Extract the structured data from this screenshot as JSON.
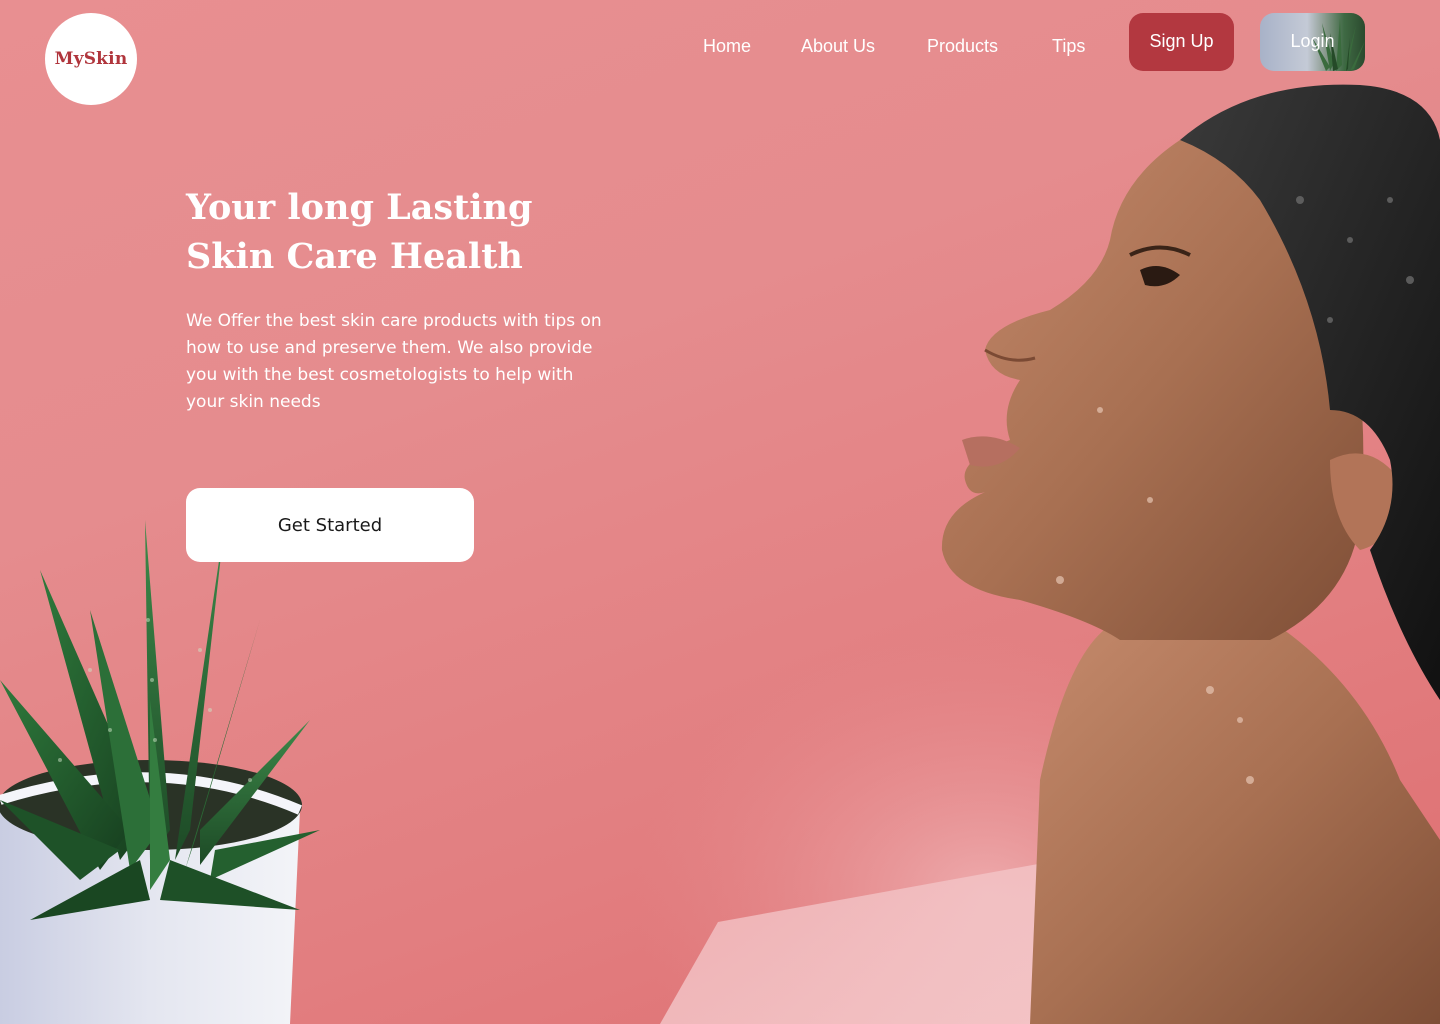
{
  "brand": {
    "logo_text": "MySkin",
    "accent_color": "#b33840",
    "background_color": "#e58c8e"
  },
  "nav": {
    "links": [
      {
        "label": "Home"
      },
      {
        "label": "About Us"
      },
      {
        "label": "Products"
      },
      {
        "label": "Tips"
      }
    ],
    "signup_label": "Sign Up",
    "login_label": "Login"
  },
  "hero": {
    "title_line1": "Your long Lasting",
    "title_line2": "Skin Care Health",
    "description": "We Offer the best skin care products with tips on how to use and preserve them. We also provide you with the best cosmetologists to help with your skin needs",
    "cta_label": "Get Started"
  },
  "images": {
    "plant": "aloe-plant-in-white-pot",
    "model": "woman-with-swim-cap-looking-up"
  }
}
